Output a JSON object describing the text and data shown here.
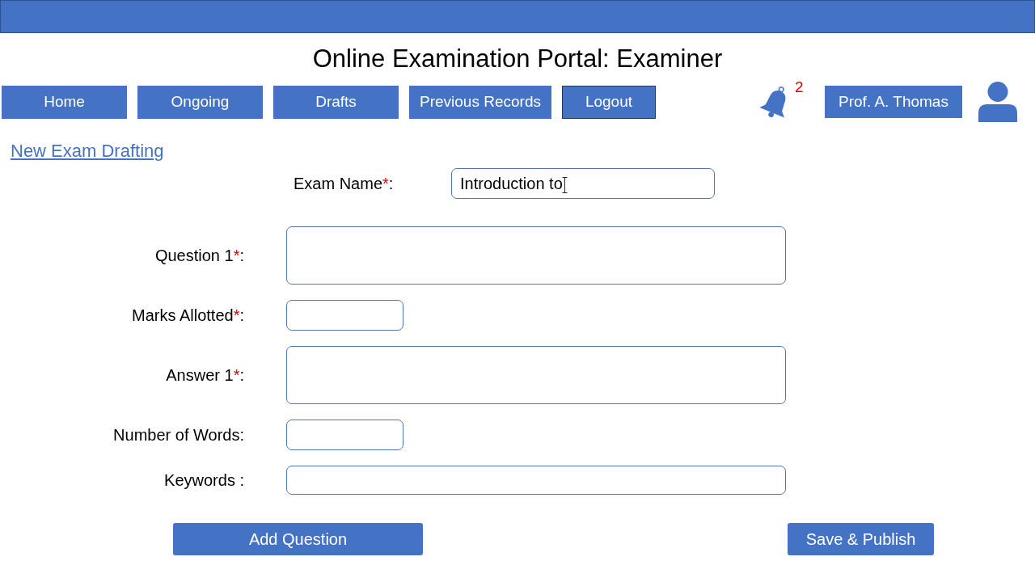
{
  "header": {
    "title": "Online Examination Portal: Examiner",
    "nav": [
      {
        "label": "Home",
        "selected": false
      },
      {
        "label": "Ongoing",
        "selected": false
      },
      {
        "label": "Drafts",
        "selected": false
      },
      {
        "label": "Previous Records",
        "selected": false
      },
      {
        "label": "Logout",
        "selected": true
      }
    ],
    "notifications": {
      "count": "2"
    },
    "user": {
      "name": "Prof. A. Thomas"
    }
  },
  "form": {
    "heading_link": "New Exam Drafting",
    "exam_name": {
      "label": "Exam Name",
      "required_mark": "*",
      "label_end": ":",
      "value": "Introduction to",
      "hovered": true
    },
    "fields": [
      {
        "label": "Question 1",
        "required_mark": "*",
        "label_end": ":",
        "kind": "box"
      },
      {
        "label": "Marks Allotted",
        "required_mark": "*",
        "label_end": ":",
        "kind": "short"
      },
      {
        "label": "Answer 1",
        "required_mark": "*",
        "label_end": ":",
        "kind": "box"
      },
      {
        "label": "Number of Words:",
        "kind": "short"
      },
      {
        "label": "Keywords :",
        "kind": "line"
      }
    ],
    "buttons": [
      "Add Question",
      "Save & Publish"
    ]
  }
}
